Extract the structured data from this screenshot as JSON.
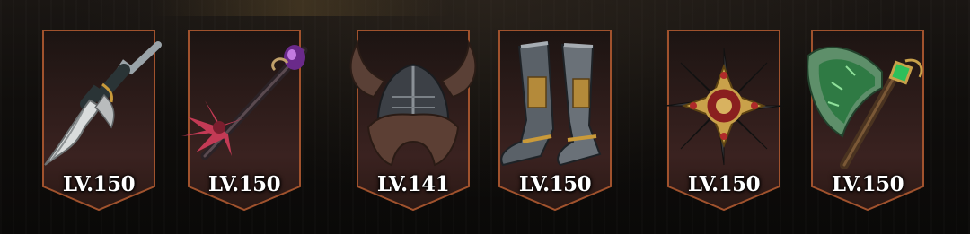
{
  "equipment": [
    {
      "slot": "weapon",
      "icon": "dagger-icon",
      "level": "LV.150"
    },
    {
      "slot": "staff",
      "icon": "staff-icon",
      "level": "LV.150"
    },
    {
      "slot": "helmet",
      "icon": "horned-helmet-icon",
      "level": "LV.141"
    },
    {
      "slot": "boots",
      "icon": "boots-icon",
      "level": "LV.150"
    },
    {
      "slot": "medal",
      "icon": "medal-icon",
      "level": "LV.150"
    },
    {
      "slot": "axe",
      "icon": "axe-icon",
      "level": "LV.150"
    }
  ],
  "colors": {
    "banner_border": "#a0522d",
    "banner_fill": "#2a1814",
    "level_text": "#ffffff"
  }
}
